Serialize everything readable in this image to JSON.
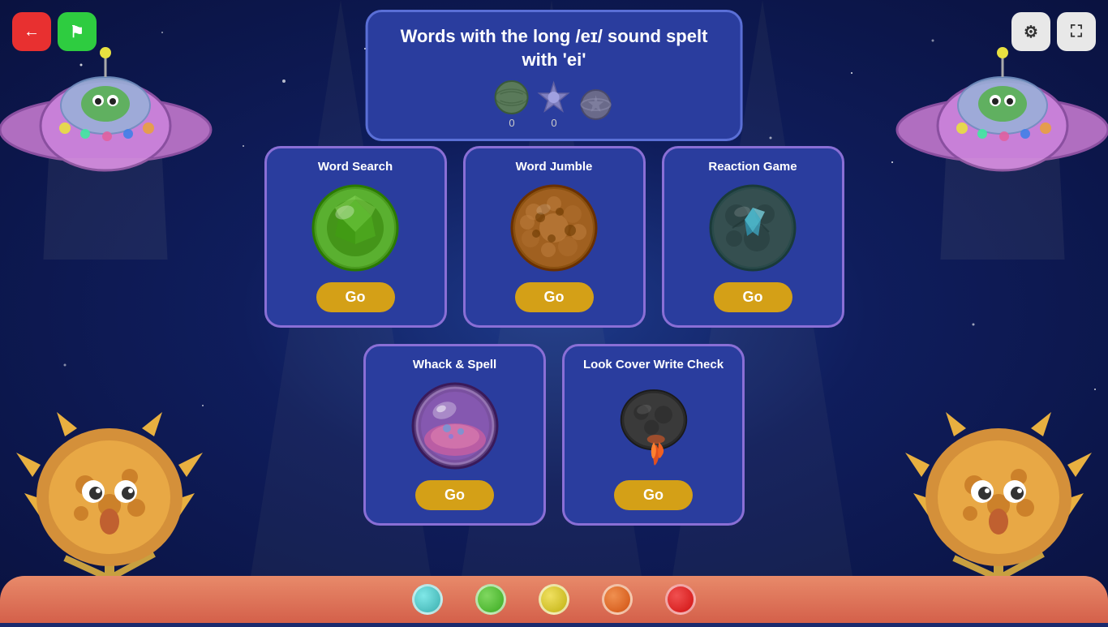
{
  "header": {
    "title_line1": "Words with the long /eɪ/ sound spelt",
    "title_line2": "with 'ei'",
    "icon1_count": "0",
    "icon2_count": "0"
  },
  "nav": {
    "back_label": "←",
    "flag_label": "⚑",
    "settings_label": "⚙",
    "expand_label": "⛶"
  },
  "games": [
    {
      "id": "word-search",
      "title": "Word Search",
      "go_label": "Go",
      "planet_color": "#6abf3a"
    },
    {
      "id": "word-jumble",
      "title": "Word Jumble",
      "go_label": "Go",
      "planet_color": "#c4872a"
    },
    {
      "id": "reaction-game",
      "title": "Reaction Game",
      "go_label": "Go",
      "planet_color": "#3a8a8a"
    },
    {
      "id": "whack-spell",
      "title": "Whack & Spell",
      "go_label": "Go",
      "planet_color": "#a07ac0"
    },
    {
      "id": "look-cover-write-check",
      "title": "Look Cover Write Check",
      "go_label": "Go",
      "planet_color": "#555"
    }
  ],
  "bottom_orbs": [
    {
      "color": "#5ecfcf"
    },
    {
      "color": "#6abf3a"
    },
    {
      "color": "#d4c020"
    },
    {
      "color": "#e87020"
    },
    {
      "color": "#e84040"
    }
  ]
}
